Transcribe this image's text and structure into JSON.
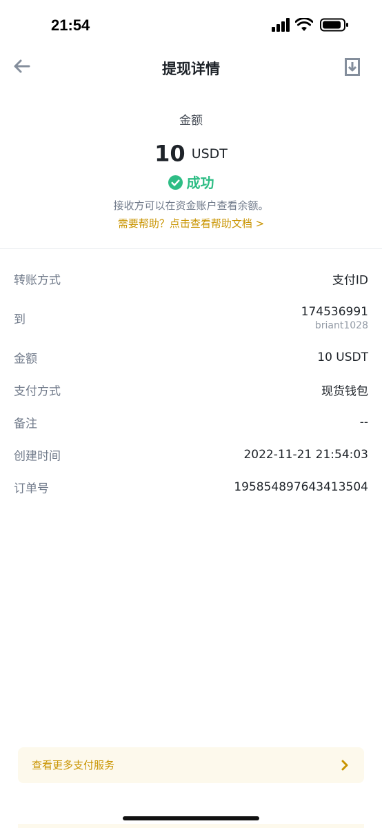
{
  "status_bar": {
    "time": "21:54"
  },
  "header": {
    "title": "提现详情"
  },
  "summary": {
    "label": "金额",
    "amount": "10",
    "currency": "USDT",
    "status": "成功",
    "note": "接收方可以在资金账户查看余额。",
    "help_link": "需要帮助？点击查看帮助文档 >"
  },
  "details": [
    {
      "label": "转账方式",
      "value": "支付ID"
    },
    {
      "label": "到",
      "value": "174536991",
      "sub": "briant1028"
    },
    {
      "label": "金额",
      "value": "10 USDT"
    },
    {
      "label": "支付方式",
      "value": "现货钱包"
    },
    {
      "label": "备注",
      "value": "--"
    },
    {
      "label": "创建时间",
      "value": "2022-11-21 21:54:03"
    },
    {
      "label": "订单号",
      "value": "195854897643413504"
    }
  ],
  "promo": {
    "label": "查看更多支付服务"
  },
  "colors": {
    "accent": "#c99400",
    "success": "#2ebd85",
    "promo_bg": "#fdf9ec",
    "divider": "#eaecef"
  }
}
